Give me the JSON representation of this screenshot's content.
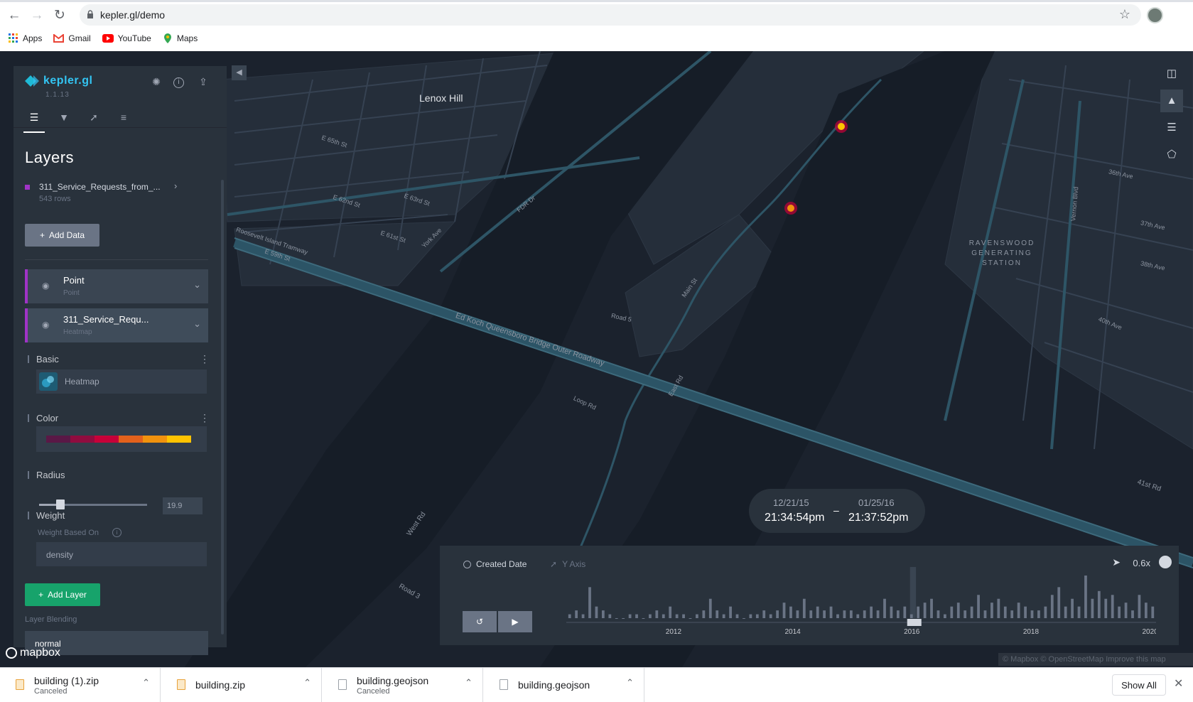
{
  "browser": {
    "url": "kepler.gl/demo",
    "bookmarks": [
      {
        "label": "Apps",
        "icon": "apps-grid-icon"
      },
      {
        "label": "Gmail",
        "icon": "gmail-icon"
      },
      {
        "label": "YouTube",
        "icon": "youtube-icon"
      },
      {
        "label": "Maps",
        "icon": "maps-icon"
      }
    ]
  },
  "app": {
    "name": "kepler.gl",
    "version": "1.1.13",
    "accent": "#33c5f3"
  },
  "panel": {
    "title": "Layers",
    "dataset": {
      "name": "311_Service_Requests_from_...",
      "rows": "543 rows",
      "color": "#a033c7"
    },
    "add_data_label": "Add Data",
    "layers": [
      {
        "name": "Point",
        "type": "Point"
      },
      {
        "name": "311_Service_Requ...",
        "type": "Heatmap"
      }
    ],
    "basic": {
      "label": "Basic",
      "layer_type": "Heatmap"
    },
    "color": {
      "label": "Color",
      "palette": [
        "#5a1846",
        "#900c3f",
        "#c70039",
        "#e3611c",
        "#f1920e",
        "#ffc300"
      ]
    },
    "radius": {
      "label": "Radius",
      "value": "19.9",
      "fraction": 0.2
    },
    "weight": {
      "label": "Weight",
      "based_on_label": "Weight Based On",
      "based_on_value": "density"
    },
    "add_layer_label": "Add Layer",
    "blending": {
      "label": "Layer Blending",
      "value": "normal"
    }
  },
  "map": {
    "labels": {
      "lenox_hill": "Lenox Hill",
      "station": "RAVENSWOOD GENERATING STATION",
      "e59": "E 59th St",
      "e61": "E 61st St",
      "e62": "E 62nd St",
      "e63": "E 63rd St",
      "e65": "E 65th St",
      "york": "York Ave",
      "fdr": "FDR Dr",
      "roosevelt": "Roosevelt Island Tramway",
      "queensboro": "Ed Koch Queensboro Bridge Outer Roadway",
      "main": "Main St",
      "west_rd": "West Rd",
      "road3": "Road 3",
      "road5": "Road 5",
      "loop": "Loop Rd",
      "east_rd": "East Rd",
      "ave36": "36th Ave",
      "ave37": "37th Ave",
      "ave38": "38th Ave",
      "ave40": "40th Ave",
      "rd41": "41st Rd",
      "vernon": "Vernon Blvd"
    },
    "tooltip": {
      "start_date": "12/21/15",
      "start_time": "21:34:54pm",
      "separator": "–",
      "end_date": "01/25/16",
      "end_time": "21:37:52pm"
    },
    "mapbox_logo": "mapbox",
    "attribution": "© Mapbox © OpenStreetMap  Improve this map"
  },
  "timeline": {
    "field": "Created Date",
    "y_axis": "Y Axis",
    "speed": "0.6x",
    "ticks": [
      "2012",
      "2014",
      "2016",
      "2018",
      "2020"
    ]
  },
  "chart_data": {
    "type": "bar",
    "title": "",
    "xlabel": "",
    "ylabel": "",
    "x_range": [
      2010.2,
      2020.1
    ],
    "tick_years": [
      2012,
      2014,
      2016,
      2018,
      2020
    ],
    "values": [
      1,
      2,
      1,
      8,
      3,
      2,
      1,
      0,
      0,
      1,
      1,
      0,
      1,
      2,
      1,
      3,
      1,
      1,
      0,
      1,
      2,
      5,
      2,
      1,
      3,
      1,
      0,
      1,
      1,
      2,
      1,
      2,
      4,
      3,
      2,
      5,
      2,
      3,
      2,
      3,
      1,
      2,
      2,
      1,
      2,
      3,
      2,
      5,
      3,
      2,
      3,
      1,
      3,
      4,
      5,
      2,
      1,
      3,
      4,
      2,
      3,
      6,
      2,
      4,
      5,
      3,
      2,
      4,
      3,
      2,
      2,
      3,
      6,
      8,
      3,
      5,
      3,
      11,
      5,
      7,
      5,
      6,
      3,
      4,
      2,
      6,
      4,
      3
    ],
    "selection": [
      2015.97,
      2016.07
    ]
  },
  "downloads": [
    {
      "name": "building (1).zip",
      "status": "Canceled"
    },
    {
      "name": "building.zip",
      "status": ""
    },
    {
      "name": "building.geojson",
      "status": "Canceled"
    },
    {
      "name": "building.geojson",
      "status": ""
    }
  ],
  "downloads_bar": {
    "show_all": "Show All"
  }
}
